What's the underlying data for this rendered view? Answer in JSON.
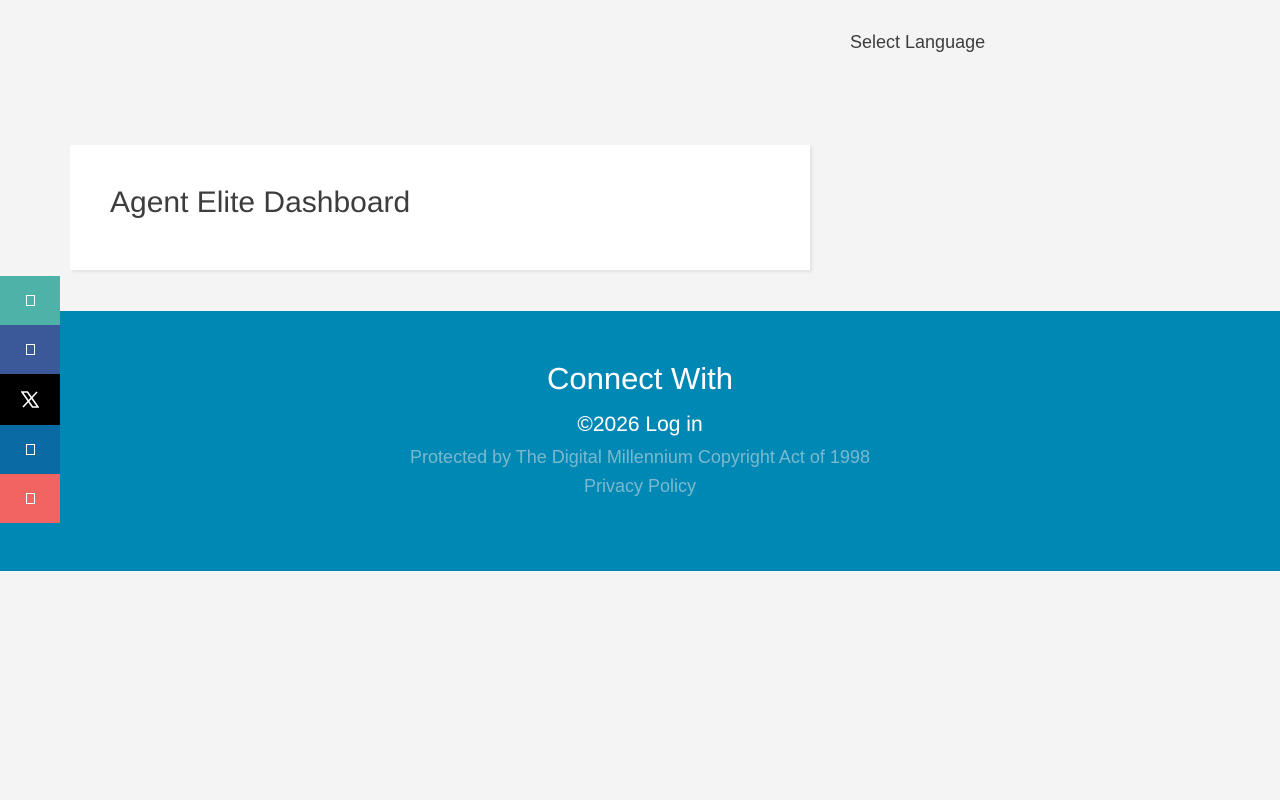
{
  "header": {
    "language_label": "Select Language"
  },
  "main": {
    "title": "Agent Elite Dashboard"
  },
  "share_bar": {
    "buttons": [
      {
        "icon": "share-icon",
        "color": "#4db2a8"
      },
      {
        "icon": "facebook-icon",
        "color": "#3b5998"
      },
      {
        "icon": "x-twitter-icon",
        "color": "#000000"
      },
      {
        "icon": "linkedin-icon",
        "color": "#0a6aa3"
      },
      {
        "icon": "email-icon",
        "color": "#f26461"
      }
    ]
  },
  "footer": {
    "background": "#0088b5",
    "connect_heading": "Connect With",
    "copyright": "©2026",
    "login_label": "Log in",
    "dmca_text": "Protected by The Digital Millennium Copyright Act of 1998",
    "privacy_label": "Privacy Policy"
  }
}
